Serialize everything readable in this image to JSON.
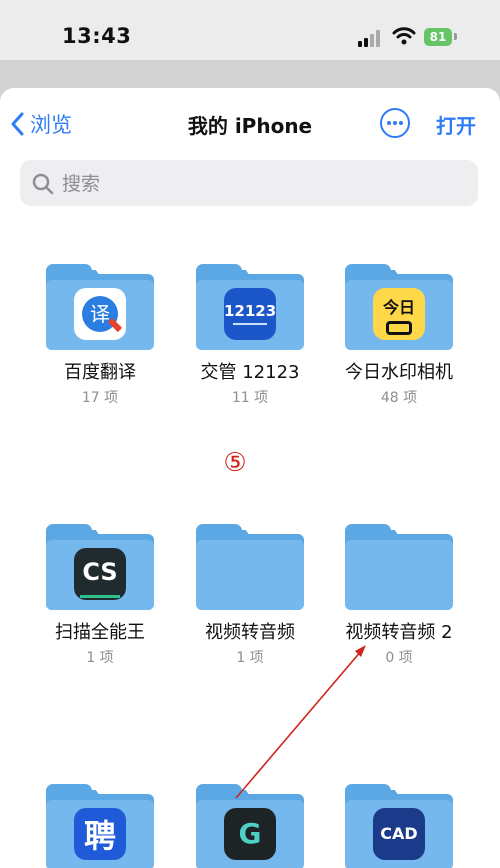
{
  "status_bar": {
    "time": "13:43",
    "battery": "81"
  },
  "nav": {
    "back_label": "浏览",
    "title": "我的 iPhone",
    "open_label": "打开"
  },
  "search": {
    "placeholder": "搜索"
  },
  "annotation": {
    "marker": "⑤",
    "color": "#d0241b"
  },
  "folders": [
    {
      "name": "百度翻译",
      "count": "17 项",
      "app": "baidu-translate-icon",
      "glyph": "译"
    },
    {
      "name": "交管 12123",
      "count": "11 项",
      "app": "traffic-12123-icon",
      "glyph": "12123"
    },
    {
      "name": "今日水印相机",
      "count": "48 项",
      "app": "watermark-camera-icon",
      "glyph": "今日"
    },
    {
      "name": "扫描全能王",
      "count": "1 项",
      "app": "camscanner-icon",
      "glyph": "CS"
    },
    {
      "name": "视频转音频",
      "count": "1 项",
      "app": ""
    },
    {
      "name": "视频转音频 2",
      "count": "0 项",
      "app": ""
    },
    {
      "name": "",
      "count": "",
      "app": "recruit-app-icon",
      "glyph": "聘"
    },
    {
      "name": "",
      "count": "",
      "app": "g-app-icon",
      "glyph": "G"
    },
    {
      "name": "",
      "count": "",
      "app": "cad-app-icon",
      "glyph": "CAD"
    }
  ],
  "colors": {
    "accent": "#2f7cf6",
    "folder": "#74b8ee",
    "battery": "#65c466"
  }
}
